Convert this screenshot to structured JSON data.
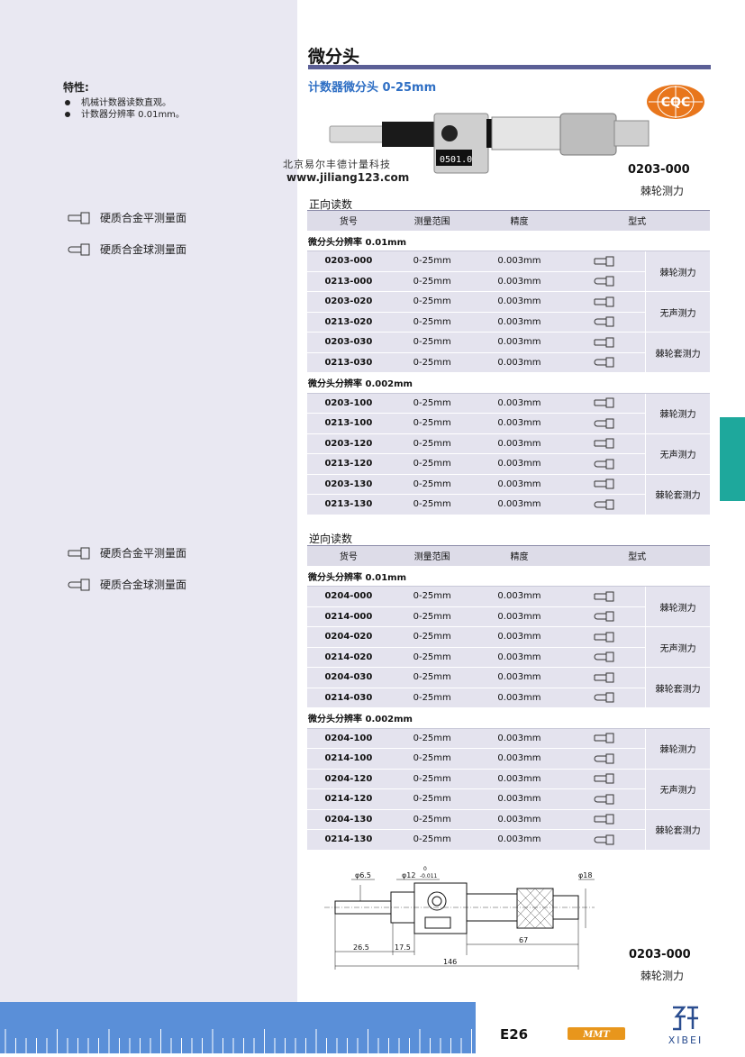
{
  "header": {
    "title": "微分头",
    "subtitle": "计数器微分头 0-25mm"
  },
  "logo_cqc": "CQC",
  "features": {
    "title": "特性:",
    "items": [
      "机械计数器读数直观。",
      "计数器分辨率 0.01mm。"
    ]
  },
  "legend_items": [
    "硬质合金平测量面",
    "硬质合金球测量面"
  ],
  "photo": {
    "counter_reading": "0501.0",
    "watermark_cn": "北京易尔丰德计量科技",
    "watermark_url": "www.jiliang123.com"
  },
  "product_top": {
    "code": "0203-000",
    "type": "棘轮测力"
  },
  "table_headers": [
    "货号",
    "测量范围",
    "精度",
    "型式"
  ],
  "forward": {
    "label": "正向读数",
    "groups": [
      {
        "title": "微分头分辨率 0.01mm",
        "rows": [
          {
            "code": "0203-000",
            "range": "0-25mm",
            "acc": "0.003mm",
            "tip": "flat",
            "force": "棘轮测力"
          },
          {
            "code": "0213-000",
            "range": "0-25mm",
            "acc": "0.003mm",
            "tip": "ball",
            "force": ""
          },
          {
            "code": "0203-020",
            "range": "0-25mm",
            "acc": "0.003mm",
            "tip": "flat",
            "force": "无声测力"
          },
          {
            "code": "0213-020",
            "range": "0-25mm",
            "acc": "0.003mm",
            "tip": "ball",
            "force": ""
          },
          {
            "code": "0203-030",
            "range": "0-25mm",
            "acc": "0.003mm",
            "tip": "flat",
            "force": "棘轮套测力"
          },
          {
            "code": "0213-030",
            "range": "0-25mm",
            "acc": "0.003mm",
            "tip": "ball",
            "force": ""
          }
        ]
      },
      {
        "title": "微分头分辨率 0.002mm",
        "rows": [
          {
            "code": "0203-100",
            "range": "0-25mm",
            "acc": "0.003mm",
            "tip": "flat",
            "force": "棘轮测力"
          },
          {
            "code": "0213-100",
            "range": "0-25mm",
            "acc": "0.003mm",
            "tip": "ball",
            "force": ""
          },
          {
            "code": "0203-120",
            "range": "0-25mm",
            "acc": "0.003mm",
            "tip": "flat",
            "force": "无声测力"
          },
          {
            "code": "0213-120",
            "range": "0-25mm",
            "acc": "0.003mm",
            "tip": "ball",
            "force": ""
          },
          {
            "code": "0203-130",
            "range": "0-25mm",
            "acc": "0.003mm",
            "tip": "flat",
            "force": "棘轮套测力"
          },
          {
            "code": "0213-130",
            "range": "0-25mm",
            "acc": "0.003mm",
            "tip": "ball",
            "force": ""
          }
        ]
      }
    ]
  },
  "reverse": {
    "label": "逆向读数",
    "groups": [
      {
        "title": "微分头分辨率 0.01mm",
        "rows": [
          {
            "code": "0204-000",
            "range": "0-25mm",
            "acc": "0.003mm",
            "tip": "flat",
            "force": "棘轮测力"
          },
          {
            "code": "0214-000",
            "range": "0-25mm",
            "acc": "0.003mm",
            "tip": "ball",
            "force": ""
          },
          {
            "code": "0204-020",
            "range": "0-25mm",
            "acc": "0.003mm",
            "tip": "flat",
            "force": "无声测力"
          },
          {
            "code": "0214-020",
            "range": "0-25mm",
            "acc": "0.003mm",
            "tip": "ball",
            "force": ""
          },
          {
            "code": "0204-030",
            "range": "0-25mm",
            "acc": "0.003mm",
            "tip": "flat",
            "force": "棘轮套测力"
          },
          {
            "code": "0214-030",
            "range": "0-25mm",
            "acc": "0.003mm",
            "tip": "ball",
            "force": ""
          }
        ]
      },
      {
        "title": "微分头分辨率 0.002mm",
        "rows": [
          {
            "code": "0204-100",
            "range": "0-25mm",
            "acc": "0.003mm",
            "tip": "flat",
            "force": "棘轮测力"
          },
          {
            "code": "0214-100",
            "range": "0-25mm",
            "acc": "0.003mm",
            "tip": "ball",
            "force": ""
          },
          {
            "code": "0204-120",
            "range": "0-25mm",
            "acc": "0.003mm",
            "tip": "flat",
            "force": "无声测力"
          },
          {
            "code": "0214-120",
            "range": "0-25mm",
            "acc": "0.003mm",
            "tip": "ball",
            "force": ""
          },
          {
            "code": "0204-130",
            "range": "0-25mm",
            "acc": "0.003mm",
            "tip": "flat",
            "force": "棘轮套测力"
          },
          {
            "code": "0214-130",
            "range": "0-25mm",
            "acc": "0.003mm",
            "tip": "ball",
            "force": ""
          }
        ]
      }
    ]
  },
  "drawing": {
    "dim_spindle": "φ6.5",
    "dim_sleeve": "φ12",
    "dim_sleeve_tol_upper": "0",
    "dim_sleeve_tol_lower": "-0.011",
    "dim_thimble": "φ18",
    "dim_a": "26.5",
    "dim_b": "17.5",
    "dim_c": "67",
    "dim_total": "146"
  },
  "product_bottom": {
    "code": "0203-000",
    "type": "棘轮测力"
  },
  "footer": {
    "page": "E26",
    "mmt_logo": "MMT",
    "brand": "XIBEI"
  },
  "colors": {
    "accent_bar": "#5b5f96",
    "subtitle": "#2f6fc4",
    "side_tab": "#1ea89c",
    "ruler": "#5a8fd8",
    "cqc_orange": "#e8761c"
  }
}
